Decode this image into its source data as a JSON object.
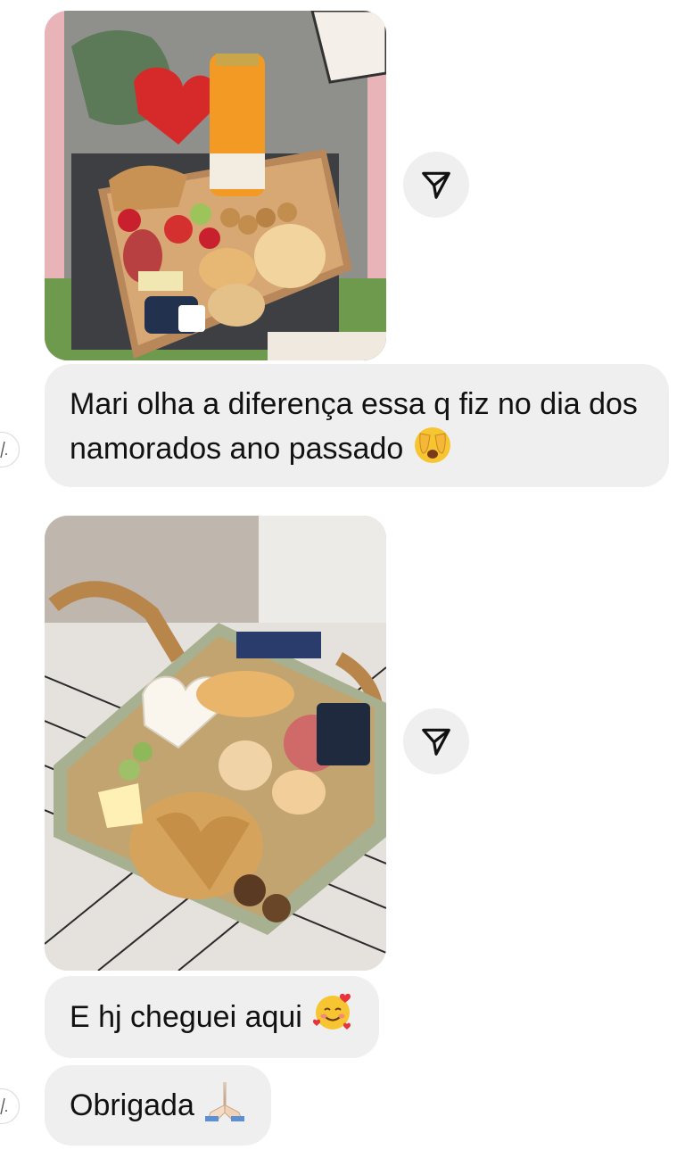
{
  "messages": [
    {
      "type": "image",
      "image": "breakfast-box-photo"
    },
    {
      "type": "text",
      "text": "Mari olha a diferença essa q fiz no dia dos namorados ano passado",
      "emoji": "face-with-hand-over-eyes-emoji"
    },
    {
      "type": "image",
      "image": "gift-box-photo"
    },
    {
      "type": "text",
      "text": "E hj cheguei aqui",
      "emoji": "smiling-face-with-hearts-emoji"
    },
    {
      "type": "text",
      "text": "Obrigada",
      "emoji": "folded-hands-emoji"
    }
  ],
  "actions": {
    "share_icon": "paper-plane-icon"
  },
  "colors": {
    "bubble_bg": "#efefef",
    "text": "#111111",
    "background": "#ffffff"
  }
}
